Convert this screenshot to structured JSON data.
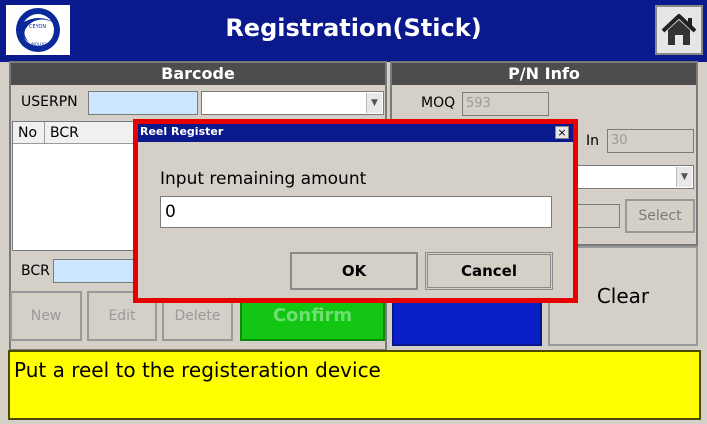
{
  "header": {
    "title": "Registration(Stick)",
    "logo_text": "CEYON TECHNOLOGY"
  },
  "barcode_panel": {
    "title": "Barcode",
    "userpn_label": "USERPN",
    "userpn_value": "",
    "userpn_combo_value": "",
    "columns": [
      "No",
      "BCR"
    ],
    "bcr_label": "BCR",
    "bcr_value": ""
  },
  "pn_info_panel": {
    "title": "P/N Info",
    "moq_label": "MOQ",
    "moq_value": "593",
    "in_label": "In",
    "in_value": "30",
    "combo_value": "",
    "select_label": "Select"
  },
  "buttons": {
    "new": "New",
    "edit": "Edit",
    "delete": "Delete",
    "confirm": "Confirm",
    "clear": "Clear"
  },
  "status": {
    "message": "Put a reel to the registeration device"
  },
  "modal": {
    "title": "Reel Register",
    "close": "×",
    "prompt": "Input remaining amount",
    "input_value": "0",
    "ok_label": "OK",
    "cancel_label": "Cancel"
  },
  "colors": {
    "header_bg": "#0a1a8c",
    "confirm_bg": "#13c613",
    "status_bg": "#ffff00",
    "modal_border": "#e60000",
    "blue_button": "#0a1fc8"
  },
  "icons": {
    "home": "home-icon",
    "logo": "company-logo",
    "dropdown": "dropdown-arrow-icon"
  }
}
